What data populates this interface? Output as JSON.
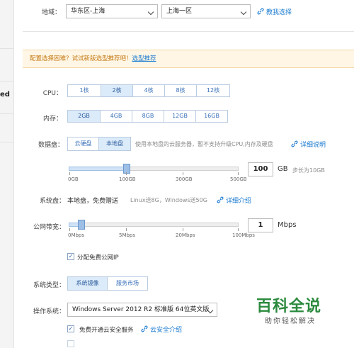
{
  "sidebar": {
    "partial_text": "ed"
  },
  "region": {
    "label": "地域：",
    "area_select": "华东区-上海",
    "zone_select": "上海一区",
    "help_link": "教我选择"
  },
  "notice": {
    "text": "配置选择困难？试试新版选型推荐吧！",
    "link": "选型推荐"
  },
  "cpu": {
    "label": "CPU：",
    "options": [
      "1核",
      "2核",
      "4核",
      "8核",
      "12核"
    ],
    "selected": "2核"
  },
  "memory": {
    "label": "内存：",
    "options": [
      "2GB",
      "4GB",
      "8GB",
      "12GB",
      "16GB"
    ],
    "selected": "2GB"
  },
  "data_disk": {
    "label": "数据盘：",
    "options": [
      "云硬盘",
      "本地盘"
    ],
    "selected": "本地盘",
    "note": "使用本地盘的云服务器，暂不支持升级CPU,内存及硬盘",
    "help_link": "详细说明",
    "slider": {
      "ticks": [
        "0GB",
        "100GB",
        "300GB",
        "500GB"
      ],
      "value": 100,
      "max": 500,
      "unit": "GB",
      "step_note": "步长为10GB"
    }
  },
  "system_disk": {
    "label": "系统盘：",
    "value": "本地盘，免费赠送",
    "note": "Linux送8G，Windows送50G",
    "help_link": "详细介绍"
  },
  "bandwidth": {
    "label": "公网带宽：",
    "slider": {
      "ticks": [
        "0Mbps",
        "5Mbps",
        "20Mbps",
        "100Mbps"
      ],
      "value": 1,
      "max": 100,
      "unit": "Mbps"
    },
    "free_ip_checkbox": {
      "checked": true,
      "label": "分配免费公网IP"
    }
  },
  "system_type": {
    "label": "系统类型：",
    "options": [
      "系统镜像",
      "服务市场"
    ],
    "selected": "系统镜像"
  },
  "os": {
    "label": "操作系统：",
    "select_value": "Windows Server 2012 R2 标准版 64位英文版",
    "security_checkbox": {
      "checked": true,
      "label": "免费开通云安全服务"
    },
    "help_link": "云安全介绍"
  },
  "watermark": {
    "title": "百科全说",
    "subtitle": "助你轻松解决"
  },
  "colors": {
    "link": "#1b7bd0",
    "notice_bg": "#fff6e5",
    "notice_text": "#c47a14",
    "selected_bg": "#dcebfa",
    "watermark_green": "#2b8a3e"
  }
}
